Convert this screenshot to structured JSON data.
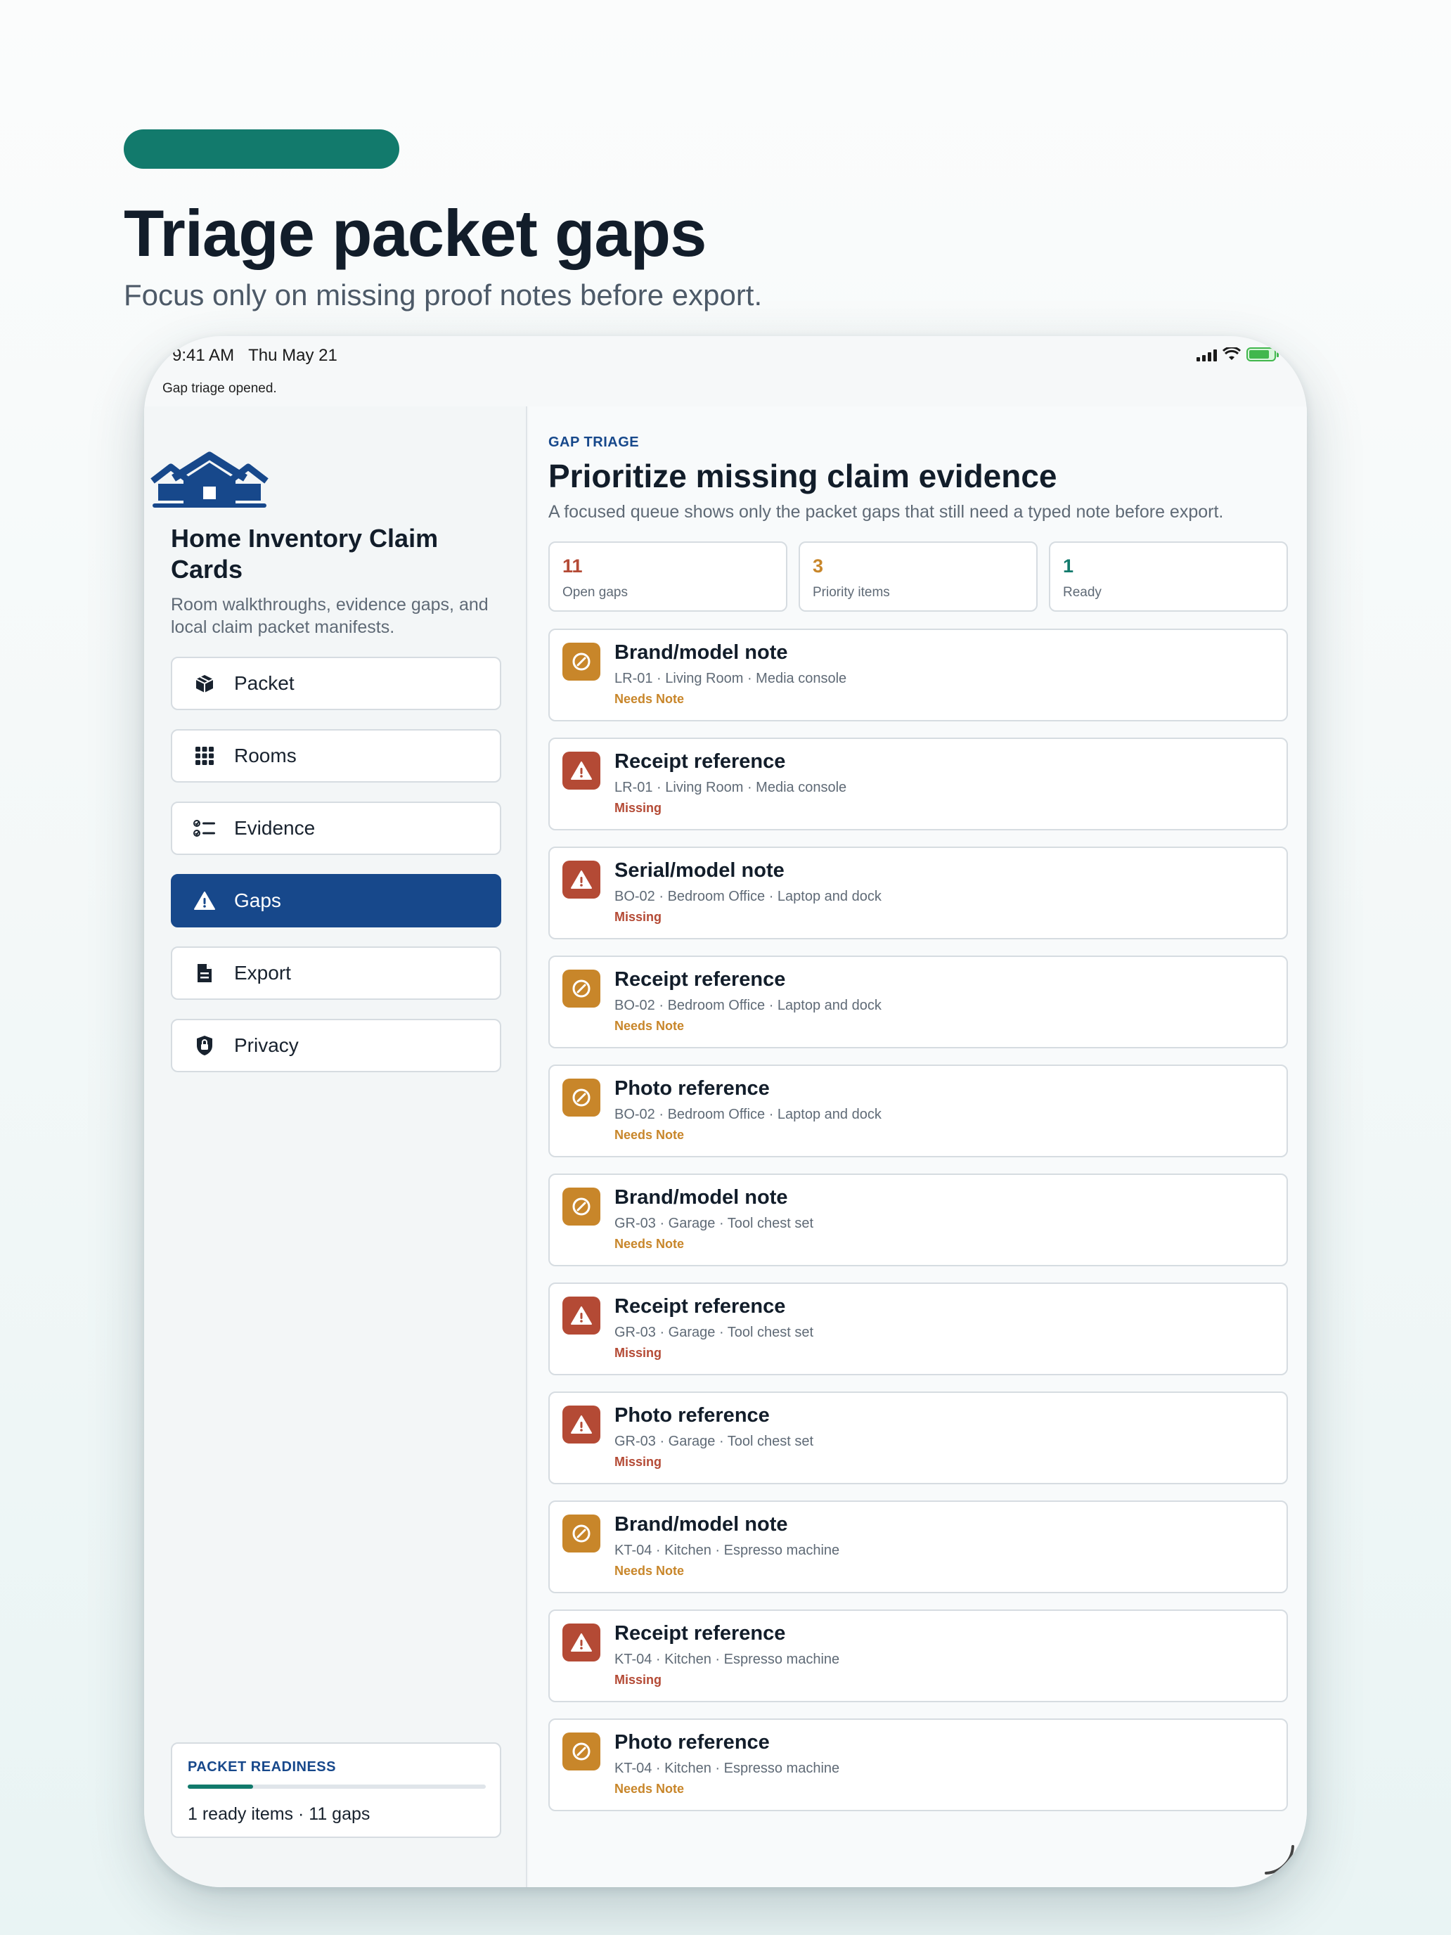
{
  "hero": {
    "title": "Triage packet gaps",
    "subtitle": "Focus only on missing proof notes before export."
  },
  "status_bar": {
    "time": "9:41 AM",
    "date": "Thu May 21",
    "toast": "Gap triage opened."
  },
  "sidebar": {
    "app_title": "Home Inventory Claim Cards",
    "app_desc": "Room walkthroughs, evidence gaps, and local claim packet manifests.",
    "nav": [
      {
        "label": "Packet",
        "icon": "box-icon"
      },
      {
        "label": "Rooms",
        "icon": "grid-icon"
      },
      {
        "label": "Evidence",
        "icon": "checklist-icon"
      },
      {
        "label": "Gaps",
        "icon": "warning-icon",
        "active": true
      },
      {
        "label": "Export",
        "icon": "document-icon"
      },
      {
        "label": "Privacy",
        "icon": "lock-shield-icon"
      }
    ],
    "readiness": {
      "label": "PACKET READINESS",
      "progress": 0.22,
      "text": "1 ready items · 11 gaps"
    }
  },
  "main": {
    "eyebrow": "GAP TRIAGE",
    "title": "Prioritize missing claim evidence",
    "desc": "A focused queue shows only the packet gaps that still need a typed note before export.",
    "stats": [
      {
        "value": "11",
        "label": "Open gaps",
        "color": "#b44a35"
      },
      {
        "value": "3",
        "label": "Priority items",
        "color": "#c8862a"
      },
      {
        "value": "1",
        "label": "Ready",
        "color": "#127a6c"
      }
    ],
    "gaps": [
      {
        "title": "Brand/model note",
        "meta": "LR-01 · Living Room · Media console",
        "status": "Needs Note",
        "kind": "note"
      },
      {
        "title": "Receipt reference",
        "meta": "LR-01 · Living Room · Media console",
        "status": "Missing",
        "kind": "missing"
      },
      {
        "title": "Serial/model note",
        "meta": "BO-02 · Bedroom Office · Laptop and dock",
        "status": "Missing",
        "kind": "missing"
      },
      {
        "title": "Receipt reference",
        "meta": "BO-02 · Bedroom Office · Laptop and dock",
        "status": "Needs Note",
        "kind": "note"
      },
      {
        "title": "Photo reference",
        "meta": "BO-02 · Bedroom Office · Laptop and dock",
        "status": "Needs Note",
        "kind": "note"
      },
      {
        "title": "Brand/model note",
        "meta": "GR-03 · Garage · Tool chest set",
        "status": "Needs Note",
        "kind": "note"
      },
      {
        "title": "Receipt reference",
        "meta": "GR-03 · Garage · Tool chest set",
        "status": "Missing",
        "kind": "missing"
      },
      {
        "title": "Photo reference",
        "meta": "GR-03 · Garage · Tool chest set",
        "status": "Missing",
        "kind": "missing"
      },
      {
        "title": "Brand/model note",
        "meta": "KT-04 · Kitchen · Espresso machine",
        "status": "Needs Note",
        "kind": "note"
      },
      {
        "title": "Receipt reference",
        "meta": "KT-04 · Kitchen · Espresso machine",
        "status": "Missing",
        "kind": "missing"
      },
      {
        "title": "Photo reference",
        "meta": "KT-04 · Kitchen · Espresso machine",
        "status": "Needs Note",
        "kind": "note"
      }
    ]
  },
  "colors": {
    "accent": "#127a6c",
    "brand": "#17488b",
    "missing": "#b44a35",
    "needs_note": "#c8862a"
  }
}
